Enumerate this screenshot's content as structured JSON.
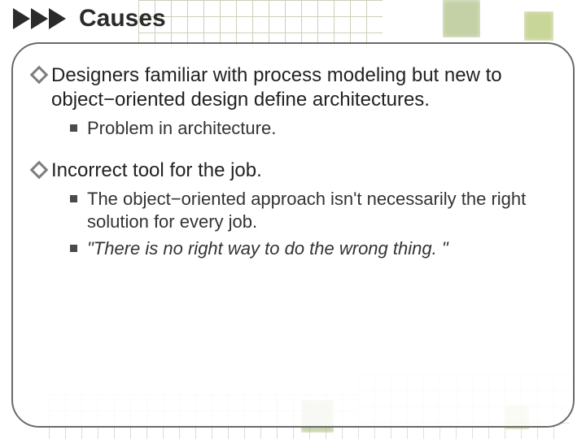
{
  "title": "Causes",
  "points": [
    {
      "text": "Designers familiar with process modeling but new to object−oriented design define architectures.",
      "subs": [
        {
          "text": "Problem in architecture.",
          "italic": false
        }
      ]
    },
    {
      "text": "Incorrect tool for the job.",
      "subs": [
        {
          "text": "The object−oriented approach isn't necessarily the right solution for every job.",
          "italic": false
        },
        {
          "text": "\"There is no right way to do the wrong thing. \"",
          "italic": true
        }
      ]
    }
  ]
}
